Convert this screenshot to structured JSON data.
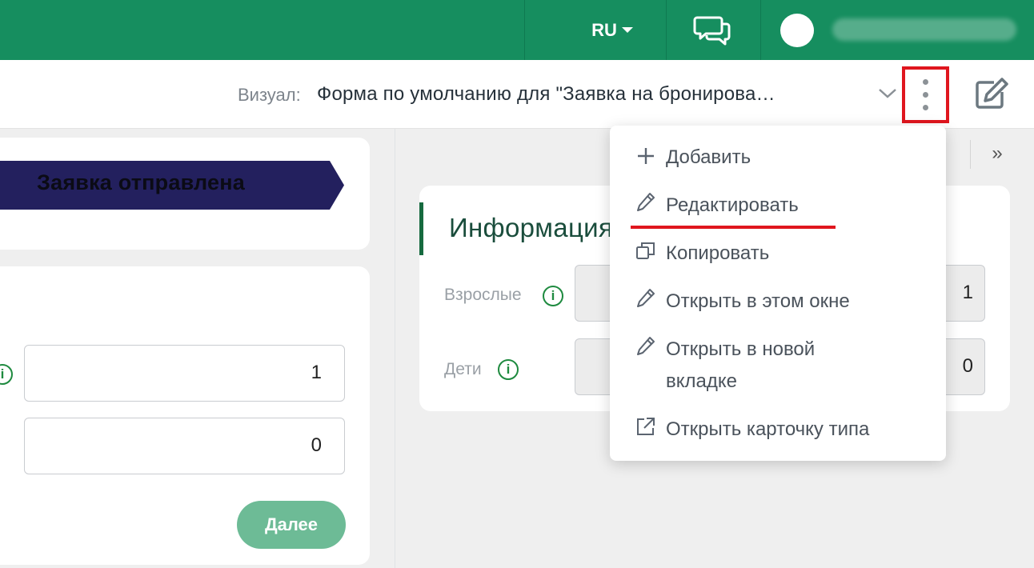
{
  "topbar": {
    "language": "RU",
    "accent_color": "#168e5f"
  },
  "header": {
    "visual_label": "Визуал:",
    "visual_value": "Форма по умолчанию для \"Заявка на бронирова…",
    "highlight_color": "#e0161e"
  },
  "left": {
    "status": "Заявка отправлена",
    "fields": [
      {
        "value": "1"
      },
      {
        "value": "0"
      }
    ],
    "next_button": "Далее"
  },
  "right": {
    "collapse_glyph": "»",
    "card_title": "Информация",
    "fields": [
      {
        "label": "Взрослые",
        "value": "1"
      },
      {
        "label": "Дети",
        "value": "0"
      }
    ]
  },
  "menu": {
    "items": [
      {
        "icon": "plus-icon",
        "label": "Добавить"
      },
      {
        "icon": "pencil-icon",
        "label": "Редактировать"
      },
      {
        "icon": "copy-icon",
        "label": "Копировать"
      },
      {
        "icon": "pencil-icon",
        "label": "Открыть в этом окне"
      },
      {
        "icon": "pencil-icon",
        "label_line1": "Открыть в новой",
        "label_line2": "вкладке"
      },
      {
        "icon": "external-link-icon",
        "label": "Открыть карточку типа"
      }
    ]
  }
}
